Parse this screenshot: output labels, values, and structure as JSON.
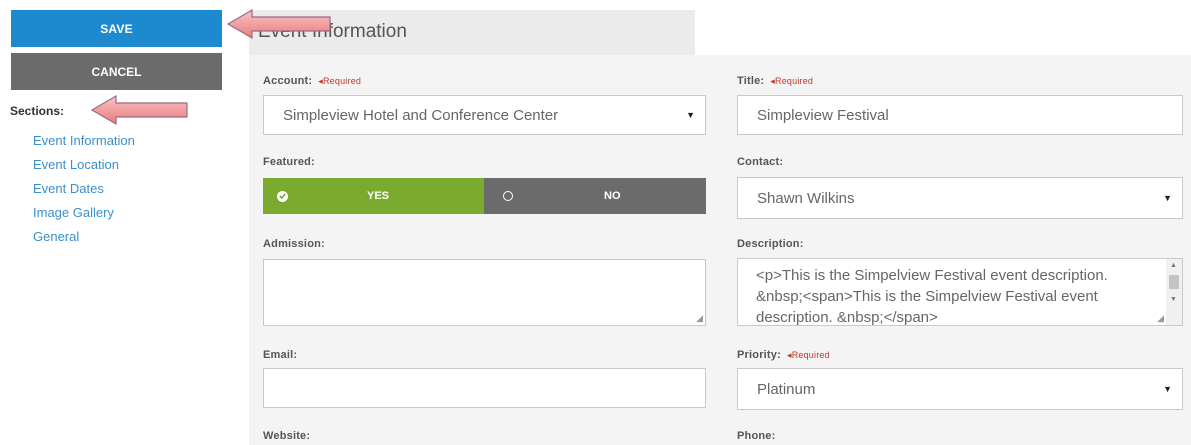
{
  "sidebar": {
    "save_label": "SAVE",
    "cancel_label": "CANCEL",
    "sections_label": "Sections:",
    "sections": [
      "Event Information",
      "Event Location",
      "Event Dates",
      "Image Gallery",
      "General"
    ]
  },
  "tab": {
    "title": "Event Information"
  },
  "form": {
    "required_text": "◂Required",
    "account": {
      "label": "Account:",
      "value": "Simpleview Hotel and Conference Center"
    },
    "title": {
      "label": "Title:",
      "value": "Simpleview Festival"
    },
    "featured": {
      "label": "Featured:",
      "yes": "YES",
      "no": "NO"
    },
    "contact": {
      "label": "Contact:",
      "value": "Shawn Wilkins"
    },
    "admission": {
      "label": "Admission:",
      "value": ""
    },
    "description": {
      "label": "Description:",
      "value": "<p>This is the Simpelview Festival event description. &nbsp;<span>This is the Simpelview Festival event description. &nbsp;</span>"
    },
    "email": {
      "label": "Email:",
      "value": ""
    },
    "priority": {
      "label": "Priority:",
      "value": "Platinum"
    },
    "website": {
      "label": "Website:"
    },
    "phone": {
      "label": "Phone:"
    }
  },
  "colors": {
    "save": "#1d8ad0",
    "cancel": "#6b6b6b",
    "yes": "#7aab2f",
    "link": "#3a8fc9",
    "required": "#c0392b",
    "arrow": "#f08a8a"
  }
}
